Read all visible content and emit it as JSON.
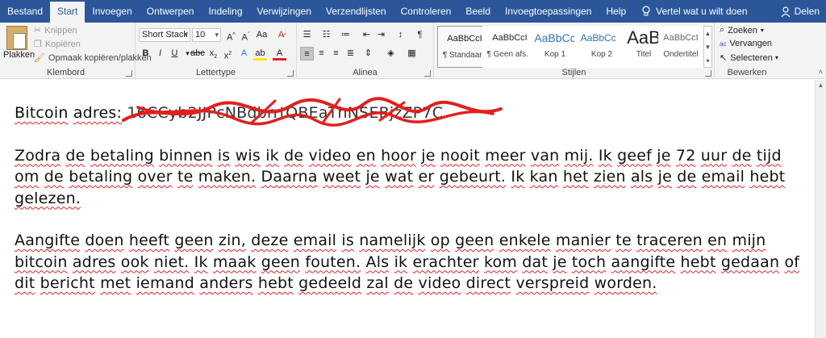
{
  "tabs": [
    "Bestand",
    "Start",
    "Invoegen",
    "Ontwerpen",
    "Indeling",
    "Verwijzingen",
    "Verzendlijsten",
    "Controleren",
    "Beeld",
    "Invoegtoepassingen",
    "Help"
  ],
  "tell_me": "Vertel wat u wilt doen",
  "share": "Delen",
  "clipboard": {
    "paste": "Plakken",
    "cut": "Knippen",
    "copy": "Kopiëren",
    "format_painter": "Opmaak kopiëren/plakken",
    "label": "Klembord"
  },
  "font": {
    "name": "Short Stack",
    "size": "10",
    "label": "Lettertype"
  },
  "paragraph": {
    "label": "Alinea"
  },
  "styles": {
    "label": "Stijlen",
    "items": [
      {
        "sample": "AaBbCcI",
        "name": "¶ Standaard"
      },
      {
        "sample": "AaBbCcI",
        "name": "¶ Geen afs..."
      },
      {
        "sample": "AaBbCc",
        "name": "Kop 1"
      },
      {
        "sample": "AaBbCcC",
        "name": "Kop 2"
      },
      {
        "sample": "AaB",
        "name": "Titel"
      },
      {
        "sample": "AaBbCcI",
        "name": "Ondertitel"
      }
    ]
  },
  "editing": {
    "find": "Zoeken",
    "replace": "Vervangen",
    "select": "Selecteren",
    "label": "Bewerken"
  },
  "document": {
    "address_label": "Bitcoin",
    "address_label2": "adres:",
    "address_value": "16CCyb2JJPcNBdbrrtQBEaThNSEBjzZP7C",
    "p1_words": [
      "Zodra",
      "de",
      "betaling",
      "binnen",
      "is",
      "wis",
      "ik",
      "de",
      "video",
      "en",
      "hoor",
      "je",
      "nooit",
      "meer",
      "van",
      "mij.",
      " Ik",
      "geef",
      "je",
      "72",
      "uur",
      "de",
      "tijd",
      "om",
      "de",
      "betaling",
      "over",
      "te",
      "maken.",
      "Daarna",
      " weet",
      "je",
      "wat",
      "er",
      "gebeurt.",
      "Ik",
      "kan",
      "het",
      "zien",
      "als",
      "je",
      "de",
      "email",
      "hebt",
      " gelezen."
    ],
    "p2_words": [
      "Aangifte",
      "doen",
      "heeft",
      "geen",
      "zin,",
      "deze",
      "email",
      "is",
      "namelijk",
      "op",
      "geen",
      "enkele",
      " manier",
      "te",
      "traceren",
      "en",
      "mijn",
      "bitcoin",
      "adres",
      "ook",
      "niet.",
      "Ik",
      "maak",
      "geen",
      "fouten.",
      "Als",
      "ik",
      " erachter",
      "kom",
      "dat",
      "je",
      "toch",
      "aangifte",
      "hebt",
      "gedaan",
      "of",
      "dit",
      "bericht",
      "met",
      "iemand",
      "anders",
      " hebt",
      "gedeeld",
      "zal",
      "de",
      "video",
      "direct",
      "verspreid",
      "worden."
    ]
  }
}
